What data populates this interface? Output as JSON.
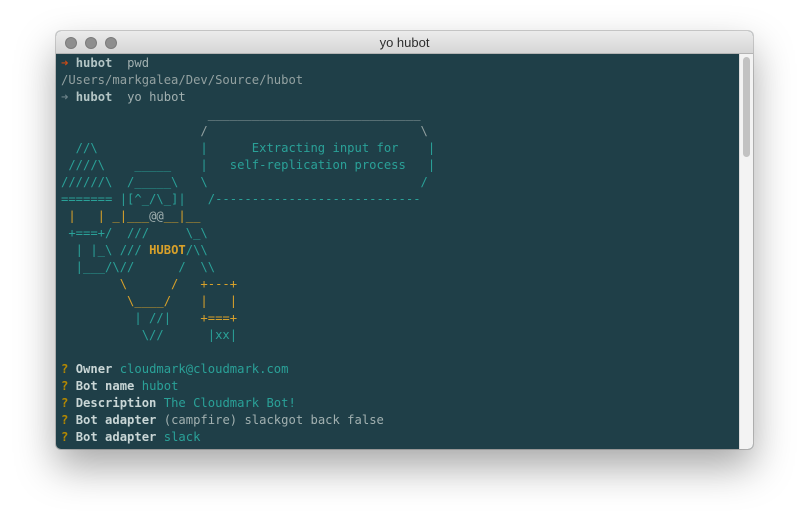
{
  "window": {
    "title": "yo hubot"
  },
  "session": {
    "cmd1": {
      "arrow": "➜",
      "host": "hubot",
      "command": "pwd"
    },
    "output1": "/Users/markgalea/Dev/Source/hubot",
    "cmd2": {
      "arrow": "➜",
      "host": "hubot",
      "command": "yo hubot"
    }
  },
  "banner": {
    "r1": {
      "a": "                    _____________________________"
    },
    "r2": {
      "a": "                   /                             \\"
    },
    "r3": {
      "a": "  //\\              |      Extracting input for    |"
    },
    "r4": {
      "a": " ////\\    _____    |   self-replication process   |"
    },
    "r5": {
      "a": "//////\\  /_____\\   \\                             /"
    },
    "r6": {
      "a": "======= |[^_/\\_]|   /----------------------------"
    },
    "r7": {
      "a": " |   | _|___",
      "b": "@@",
      "c": "__|__"
    },
    "r8": {
      "a": " +===+/  ///     \\_\\"
    },
    "r9": {
      "a": "  | |_\\ /// ",
      "b": "HUBOT",
      "c": "/\\\\"
    },
    "r10": {
      "a": "  |___/\\//      /  \\\\"
    },
    "r11": {
      "a": "        \\      /   ",
      "b": "+---+"
    },
    "r12": {
      "a": "         \\____/    |   |"
    },
    "r13": {
      "a": "          | //|    ",
      "b": "+===+"
    },
    "r14": {
      "a": "           \\//      |xx|"
    }
  },
  "prompts": [
    {
      "q": "?",
      "label": "Owner",
      "answer": "cloudmark@cloudmark.com"
    },
    {
      "q": "?",
      "label": "Bot name",
      "answer": "hubot"
    },
    {
      "q": "?",
      "label": "Description",
      "answer": "The Cloudmark Bot!"
    },
    {
      "q": "?",
      "label": "Bot adapter",
      "pending": "(campfire) slackgot back false"
    },
    {
      "q": "?",
      "label": "Bot adapter",
      "answer": "slack"
    }
  ],
  "colors": {
    "terminal_bg": "#1f3f48",
    "prompt_arrow": "#cb4b16",
    "accent_cyan": "#2aa198",
    "accent_gold": "#d8a12a",
    "question_mark": "#b58900"
  }
}
